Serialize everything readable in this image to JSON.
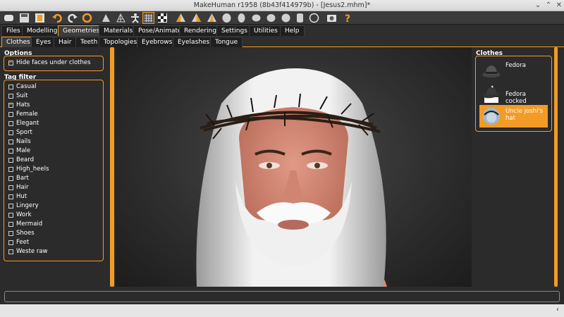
{
  "window": {
    "title": "MakeHuman r1958 (8b43f414979b) - [Jesus2.mhm]*"
  },
  "toolbar_icons": [
    "new-file-icon",
    "save-icon",
    "export-icon",
    "undo-icon",
    "redo-icon",
    "reset-icon",
    "smooth-icon",
    "wireframe-icon",
    "pose-icon",
    "grid-icon",
    "checker-icon",
    "front-view-icon",
    "back-view-icon",
    "left-view-icon",
    "right-view-icon",
    "top-view-icon",
    "bottom-view-icon",
    "reset-camera-icon",
    "rotate-icon",
    "screenshot-icon",
    "help-icon"
  ],
  "main_tabs": [
    "Files",
    "Modelling",
    "Geometries",
    "Materials",
    "Pose/Animate",
    "Rendering",
    "Settings",
    "Utilities",
    "Help"
  ],
  "sub_tabs": [
    "Clothes",
    "Eyes",
    "Hair",
    "Teeth",
    "Topologies",
    "Eyebrows",
    "Eyelashes",
    "Tongue"
  ],
  "options": {
    "title": "Options",
    "hide_faces": "Hide faces under clothes",
    "hide_faces_checked": true
  },
  "tag_filter": {
    "title": "Tag filter",
    "tags": [
      {
        "label": "Casual",
        "checked": false
      },
      {
        "label": "Suit",
        "checked": false
      },
      {
        "label": "Hats",
        "checked": true
      },
      {
        "label": "Female",
        "checked": false
      },
      {
        "label": "Elegant",
        "checked": false
      },
      {
        "label": "Sport",
        "checked": false
      },
      {
        "label": "Nails",
        "checked": false
      },
      {
        "label": "Male",
        "checked": false
      },
      {
        "label": "Beard",
        "checked": false
      },
      {
        "label": "High_heels",
        "checked": false
      },
      {
        "label": "Bart",
        "checked": false
      },
      {
        "label": "Hair",
        "checked": false
      },
      {
        "label": "Hut",
        "checked": false
      },
      {
        "label": "Lingery",
        "checked": false
      },
      {
        "label": "Work",
        "checked": false
      },
      {
        "label": "Mermaid",
        "checked": false
      },
      {
        "label": "Shoes",
        "checked": false
      },
      {
        "label": "Feet",
        "checked": false
      },
      {
        "label": "Weste raw",
        "checked": false
      }
    ]
  },
  "clothes": {
    "title": "Clothes",
    "items": [
      {
        "label": "Fedora",
        "selected": false
      },
      {
        "label": "Fedora cocked",
        "selected": false
      },
      {
        "label": "Uncle joshi's hat",
        "selected": true
      }
    ]
  },
  "colors": {
    "accent": "#f29b25",
    "bg": "#2b2b2b"
  }
}
